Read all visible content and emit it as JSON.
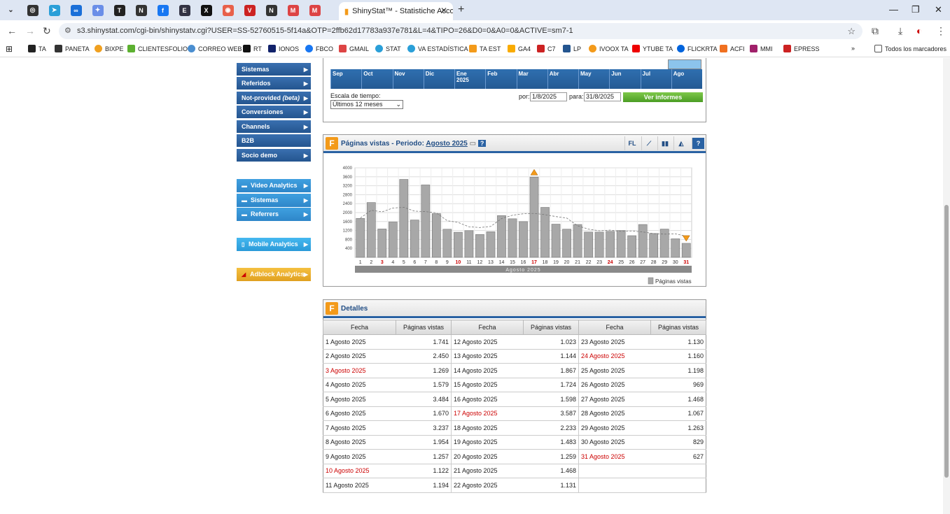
{
  "browser": {
    "active_tab_title": "ShinyStat™ - Statistiche Account",
    "url": "s3.shinystat.com/cgi-bin/shinystatv.cgi?USER=SS-52760515-5f14a&OTP=2ffb62d17783a937e781&L=4&TIPO=26&D0=0&A0=0&ACTIVE=sm7-1",
    "bookmarks": [
      "TA",
      "PANETA",
      "BIXPE",
      "CLIENTESFOLIO",
      "CORREO WEB",
      "RT",
      "IONOS",
      "FBCO",
      "GMAIL",
      "STAT",
      "VA ESTADÍSTICA",
      "TA EST",
      "GA4",
      "C7",
      "LP",
      "IVOOX TA",
      "YTUBE TA",
      "FLICKRTA",
      "ACFI",
      "MMI",
      "EPRESS"
    ],
    "all_bookmarks": "Todos los marcadores"
  },
  "sidebar": {
    "items": [
      "Sistemas",
      "Referidos",
      "Not-provided",
      "Conversiones",
      "Channels",
      "B2B",
      "Socio demo"
    ],
    "not_provided_suffix": "(beta)",
    "video": [
      "Video Analytics",
      "Sistemas",
      "Referrers"
    ],
    "mobile": "Mobile Analytics",
    "adblock": "Adblock Analytics"
  },
  "timeline": {
    "months": [
      "Sep",
      "Oct",
      "Nov",
      "Dic",
      "Ene",
      "Feb",
      "Mar",
      "Abr",
      "May",
      "Jun",
      "Jul",
      "Ago"
    ],
    "year": "2025",
    "scale_label": "Escala de tiempo:",
    "scale_value": "Últimos 12 meses",
    "por_label": "por:",
    "por_value": "1/8/2025",
    "para_label": "para:",
    "para_value": "31/8/2025",
    "button": "Ver informes"
  },
  "chart_panel": {
    "title": "Páginas vistas - Periodo:",
    "period": "Agosto 2025",
    "fl": "FL",
    "help": "?",
    "icon": "F"
  },
  "chart_data": {
    "type": "bar",
    "title": "Páginas vistas - Periodo: Agosto 2025",
    "categories": [
      "1",
      "2",
      "3",
      "4",
      "5",
      "6",
      "7",
      "8",
      "9",
      "10",
      "11",
      "12",
      "13",
      "14",
      "15",
      "16",
      "17",
      "18",
      "19",
      "20",
      "21",
      "22",
      "23",
      "24",
      "25",
      "26",
      "27",
      "28",
      "29",
      "30",
      "31"
    ],
    "red_categories": [
      "3",
      "10",
      "17",
      "24",
      "31"
    ],
    "series": [
      {
        "name": "Páginas vistas",
        "values": [
          1741,
          2450,
          1269,
          1579,
          3484,
          1670,
          3237,
          1954,
          1257,
          1122,
          1194,
          1023,
          1144,
          1867,
          1724,
          1598,
          3587,
          2233,
          1483,
          1259,
          1468,
          1131,
          1130,
          1160,
          1198,
          969,
          1468,
          1067,
          1263,
          829,
          627
        ]
      }
    ],
    "yticks": [
      "4000",
      "3600",
      "3200",
      "2800",
      "2400",
      "2000",
      "1600",
      "1200",
      "800",
      "400"
    ],
    "ylim": [
      0,
      4000
    ],
    "xlabel": "Agosto 2025",
    "legend": "Páginas vistas",
    "grid": true,
    "trend_line": true
  },
  "details": {
    "title": "Detalles",
    "col_fecha": "Fecha",
    "col_paginas": "Páginas vistas",
    "rows": [
      {
        "date": "1 Agosto 2025",
        "value": "1.741",
        "red": false
      },
      {
        "date": "2 Agosto 2025",
        "value": "2.450",
        "red": false
      },
      {
        "date": "3 Agosto 2025",
        "value": "1.269",
        "red": true
      },
      {
        "date": "4 Agosto 2025",
        "value": "1.579",
        "red": false
      },
      {
        "date": "5 Agosto 2025",
        "value": "3.484",
        "red": false
      },
      {
        "date": "6 Agosto 2025",
        "value": "1.670",
        "red": false
      },
      {
        "date": "7 Agosto 2025",
        "value": "3.237",
        "red": false
      },
      {
        "date": "8 Agosto 2025",
        "value": "1.954",
        "red": false
      },
      {
        "date": "9 Agosto 2025",
        "value": "1.257",
        "red": false
      },
      {
        "date": "10 Agosto 2025",
        "value": "1.122",
        "red": true
      },
      {
        "date": "11 Agosto 2025",
        "value": "1.194",
        "red": false
      },
      {
        "date": "12 Agosto 2025",
        "value": "1.023",
        "red": false
      },
      {
        "date": "13 Agosto 2025",
        "value": "1.144",
        "red": false
      },
      {
        "date": "14 Agosto 2025",
        "value": "1.867",
        "red": false
      },
      {
        "date": "15 Agosto 2025",
        "value": "1.724",
        "red": false
      },
      {
        "date": "16 Agosto 2025",
        "value": "1.598",
        "red": false
      },
      {
        "date": "17 Agosto 2025",
        "value": "3.587",
        "red": true
      },
      {
        "date": "18 Agosto 2025",
        "value": "2.233",
        "red": false
      },
      {
        "date": "19 Agosto 2025",
        "value": "1.483",
        "red": false
      },
      {
        "date": "20 Agosto 2025",
        "value": "1.259",
        "red": false
      },
      {
        "date": "21 Agosto 2025",
        "value": "1.468",
        "red": false
      },
      {
        "date": "22 Agosto 2025",
        "value": "1.131",
        "red": false
      },
      {
        "date": "23 Agosto 2025",
        "value": "1.130",
        "red": false
      },
      {
        "date": "24 Agosto 2025",
        "value": "1.160",
        "red": true
      },
      {
        "date": "25 Agosto 2025",
        "value": "1.198",
        "red": false
      },
      {
        "date": "26 Agosto 2025",
        "value": "969",
        "red": false
      },
      {
        "date": "27 Agosto 2025",
        "value": "1.468",
        "red": false
      },
      {
        "date": "28 Agosto 2025",
        "value": "1.067",
        "red": false
      },
      {
        "date": "29 Agosto 2025",
        "value": "1.263",
        "red": false
      },
      {
        "date": "30 Agosto 2025",
        "value": "829",
        "red": false
      },
      {
        "date": "31 Agosto 2025",
        "value": "627",
        "red": true
      }
    ]
  }
}
